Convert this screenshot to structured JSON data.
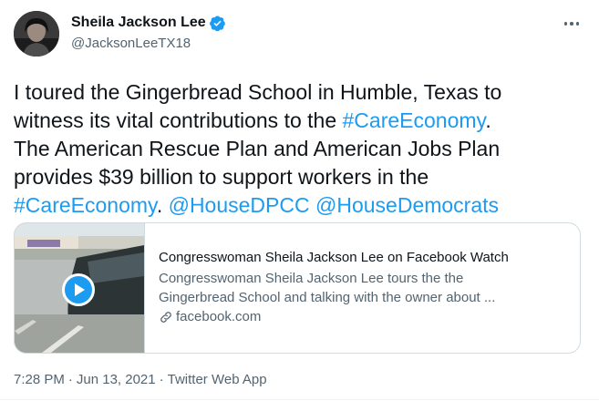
{
  "author": {
    "display_name": "Sheila Jackson Lee",
    "handle": "@JacksonLeeTX18",
    "verified": true
  },
  "menu": {
    "icon": "more-horizontal-icon"
  },
  "tweet": {
    "line1": "I toured the Gingerbread School in Humble, Texas to",
    "line2_text": "witness its vital contributions to the ",
    "line2_hashtag": "#CareEconomy",
    "line2_end": ".",
    "line3": "The American Rescue Plan and American Jobs Plan",
    "line4": "provides $39 billion to support workers in the",
    "line5_hashtag": "#CareEconomy",
    "line5_mid": ". ",
    "mention1": "@HouseDPCC",
    "mention2": "@HouseDemocrats"
  },
  "card": {
    "title": "Congresswoman Sheila Jackson Lee on Facebook Watch",
    "desc_line1": "Congresswoman Sheila Jackson Lee tours the the",
    "desc_line2": "Gingerbread School and talking with the owner about ...",
    "domain": "facebook.com",
    "play_icon": "play-icon",
    "link_icon": "link-icon"
  },
  "meta": {
    "time": "7:28 PM",
    "separator": "·",
    "date": "Jun 13, 2021",
    "source": "Twitter Web App"
  },
  "colors": {
    "accent": "#1d9bf0",
    "text": "#0f1419",
    "muted": "#536471",
    "border": "#cfd9de"
  }
}
